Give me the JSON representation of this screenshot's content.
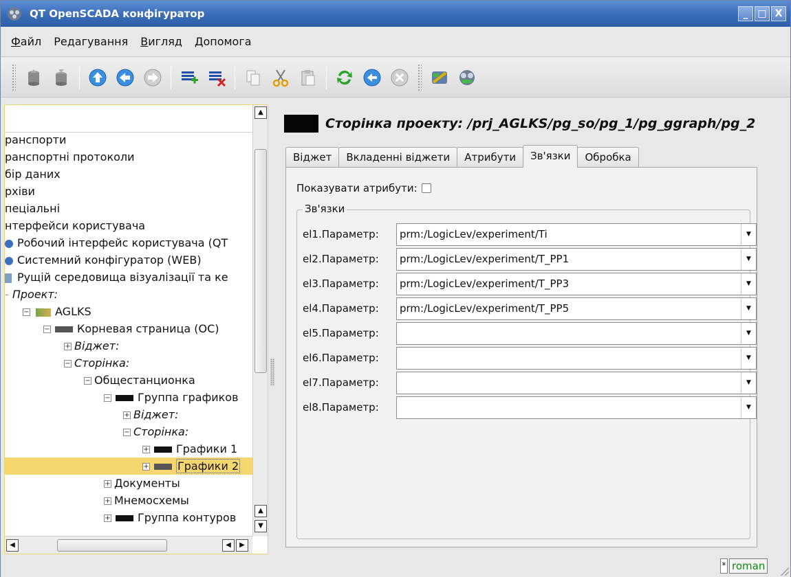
{
  "window": {
    "title": "QT OpenSCADA конфігуратор",
    "buttons": {
      "minimize": "_",
      "maximize": "□",
      "close": "X"
    }
  },
  "menu": [
    {
      "label": "Файл",
      "accel": "Ф",
      "rest": "айл"
    },
    {
      "label": "Редагування"
    },
    {
      "label": "Вигляд",
      "accel": "В",
      "rest": "игляд"
    },
    {
      "label": "Допомога",
      "accel": "Д",
      "rest": "опомога"
    }
  ],
  "toolbar": {
    "icons": [
      "db-load-icon",
      "db-save-icon",
      "up-icon",
      "back-icon",
      "forward-icon",
      "add-item-icon",
      "delete-item-icon",
      "copy-icon",
      "cut-icon",
      "paste-icon",
      "refresh-icon",
      "start-icon",
      "stop-icon",
      "vision-icon",
      "configurator-icon"
    ]
  },
  "tree": {
    "rows": [
      {
        "text": "ранспорти"
      },
      {
        "text": "ранспортні протоколи"
      },
      {
        "text": "бір даних"
      },
      {
        "text": "рхіви"
      },
      {
        "text": "пеціальні"
      },
      {
        "text": "нтерфейси користувача"
      },
      {
        "text": "Робочий інтерфейс користувача (QT"
      },
      {
        "text": "Системний конфігуратор (WEB)"
      },
      {
        "text": "Рущій середовища візуалізації та ке"
      },
      {
        "text": "Проект:"
      },
      {
        "text": "AGLKS"
      },
      {
        "text": "Корневая страница (ОС)"
      },
      {
        "text": "Віджет:"
      },
      {
        "text": "Сторінка:"
      },
      {
        "text": "Общестанционка"
      },
      {
        "text": "Группа графиков"
      },
      {
        "text": "Віджет:"
      },
      {
        "text": "Сторінка:"
      },
      {
        "text": "Графики 1"
      },
      {
        "text": "Графики 2"
      },
      {
        "text": "Документы"
      },
      {
        "text": "Мнемосхемы"
      },
      {
        "text": "Группа контуров"
      }
    ],
    "selected": "Графики 2"
  },
  "page": {
    "title": "Сторінка проекту: /prj_AGLKS/pg_so/pg_1/pg_ggraph/pg_2",
    "swatch_color": "#050505",
    "tabs": [
      "Віджет",
      "Вкладенні віджети",
      "Атрибути",
      "Зв'язки",
      "Обробка"
    ],
    "active_tab": "Зв'язки",
    "show_attributes_label": "Показувати атрибути:",
    "show_attributes_checked": false,
    "group_title": "Зв'язки",
    "params": [
      {
        "label": "el1.Параметр:",
        "value": "prm:/LogicLev/experiment/Ti"
      },
      {
        "label": "el2.Параметр:",
        "value": "prm:/LogicLev/experiment/T_PP1"
      },
      {
        "label": "el3.Параметр:",
        "value": "prm:/LogicLev/experiment/T_PP3"
      },
      {
        "label": "el4.Параметр:",
        "value": "prm:/LogicLev/experiment/T_PP5"
      },
      {
        "label": "el5.Параметр:",
        "value": ""
      },
      {
        "label": "el6.Параметр:",
        "value": ""
      },
      {
        "label": "el7.Параметр:",
        "value": ""
      },
      {
        "label": "el8.Параметр:",
        "value": ""
      }
    ]
  },
  "status": {
    "modified_mark": "*",
    "user": "roman",
    "user_color": "#0f8a0f"
  }
}
